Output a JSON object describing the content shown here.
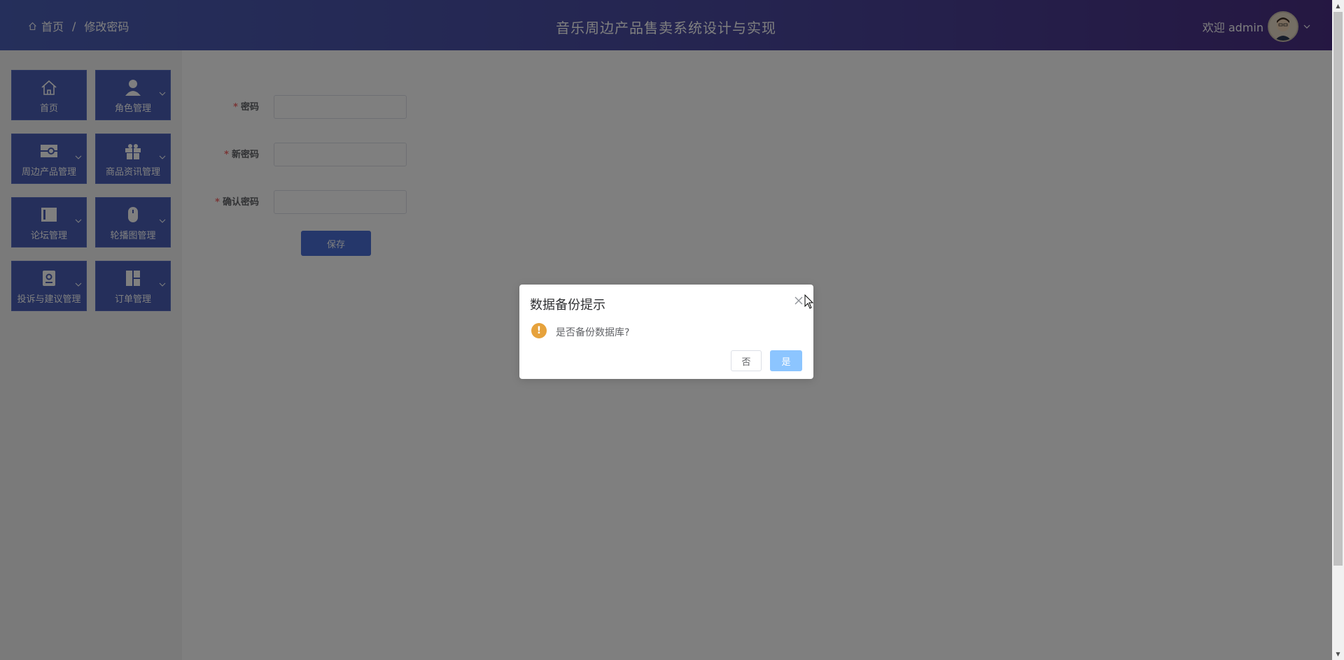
{
  "header": {
    "breadcrumb": {
      "home": "首页",
      "separator": "/",
      "current": "修改密码"
    },
    "app_title": "音乐周边产品售卖系统设计与实现",
    "welcome": "欢迎 admin",
    "colors": {
      "gradient_start": "#4a5fb6",
      "gradient_end": "#4a2f84"
    }
  },
  "sidebar": {
    "items": [
      {
        "label": "首页",
        "icon": "home-icon",
        "has_submenu": false
      },
      {
        "label": "角色管理",
        "icon": "user-icon",
        "has_submenu": true
      },
      {
        "label": "周边产品管理",
        "icon": "product-icon",
        "has_submenu": true
      },
      {
        "label": "商品资讯管理",
        "icon": "gift-icon",
        "has_submenu": true
      },
      {
        "label": "论坛管理",
        "icon": "board-icon",
        "has_submenu": true
      },
      {
        "label": "轮播图管理",
        "icon": "mouse-icon",
        "has_submenu": true
      },
      {
        "label": "投诉与建议管理",
        "icon": "badge-icon",
        "has_submenu": true
      },
      {
        "label": "订单管理",
        "icon": "layout-icon",
        "has_submenu": true
      }
    ],
    "tile_color": "#4a5fb6"
  },
  "form": {
    "required_mark": "*",
    "fields": [
      {
        "label": "密码",
        "value": ""
      },
      {
        "label": "新密码",
        "value": ""
      },
      {
        "label": "确认密码",
        "value": ""
      }
    ],
    "save_label": "保存"
  },
  "dialog": {
    "title": "数据备份提示",
    "message": "是否备份数据库?",
    "icon": "warning-icon",
    "warning_glyph": "!",
    "no_label": "否",
    "yes_label": "是",
    "colors": {
      "warning": "#e6a23c",
      "primary": "#8cc5ff"
    }
  }
}
